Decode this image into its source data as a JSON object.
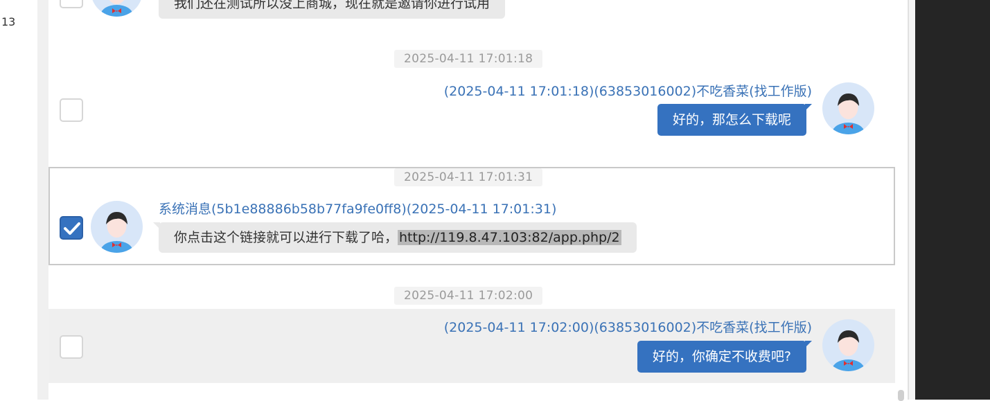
{
  "gutter": {
    "line_number": "13"
  },
  "messages": [
    {
      "side": "left",
      "text": "我们还在测试所以没上商城，现在就是邀请你进行试用",
      "selected": false
    },
    {
      "side": "right",
      "timestamp": "2025-04-11 17:01:18",
      "sender": "(2025-04-11 17:01:18)(63853016002)不吃香菜(找工作版)",
      "text": "好的，那怎么下载呢",
      "selected": false
    },
    {
      "side": "left",
      "timestamp": "2025-04-11 17:01:31",
      "sender": "系统消息(5b1e88886b58b77fa9fe0ff8)(2025-04-11 17:01:31)",
      "text": "你点击这个链接就可以进行下载了哈，",
      "link": "http://119.8.47.103:82/app.php/2",
      "selected": true
    },
    {
      "side": "right",
      "timestamp": "2025-04-11 17:02:00",
      "sender": "(2025-04-11 17:02:00)(63853016002)不吃香菜(找工作版)",
      "text": "好的，你确定不收费吧?",
      "selected": false
    }
  ],
  "colors": {
    "accent": "#3572c0",
    "sender_text": "#3a72b6",
    "left_bubble": "#e9e9e9",
    "timestamp_text": "#9a9a9a",
    "hover_row": "#efefef"
  }
}
